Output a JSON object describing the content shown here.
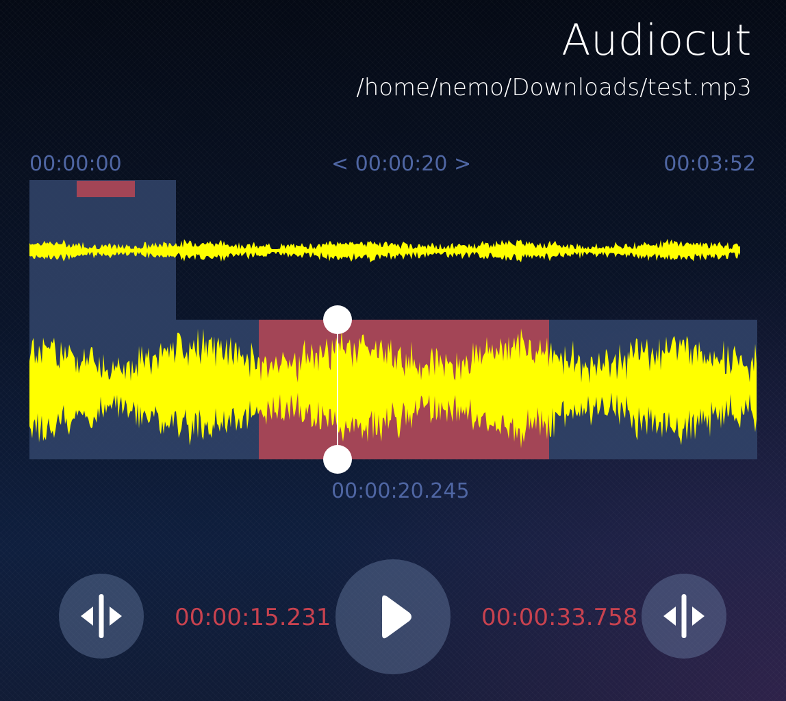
{
  "app": {
    "title": "Audiocut",
    "file_path": "/home/nemo/Downloads/test.mp3"
  },
  "overview": {
    "start_time": "00:00:00",
    "zoom_window": "< 00:00:20 >",
    "end_time": "00:03:52"
  },
  "detail": {
    "cursor_time": "00:00:20.245"
  },
  "controls": {
    "selection_start": "00:00:15.231",
    "selection_end": "00:00:33.758",
    "mark_start_icon": "split-marker-icon",
    "play_icon": "play-icon",
    "mark_end_icon": "split-marker-icon"
  },
  "colors": {
    "waveform": "#ffff00",
    "selection": "#a34556",
    "visible_window": "#3a4a6e",
    "time_label": "#4f66a3",
    "selection_time": "#c8424f"
  }
}
